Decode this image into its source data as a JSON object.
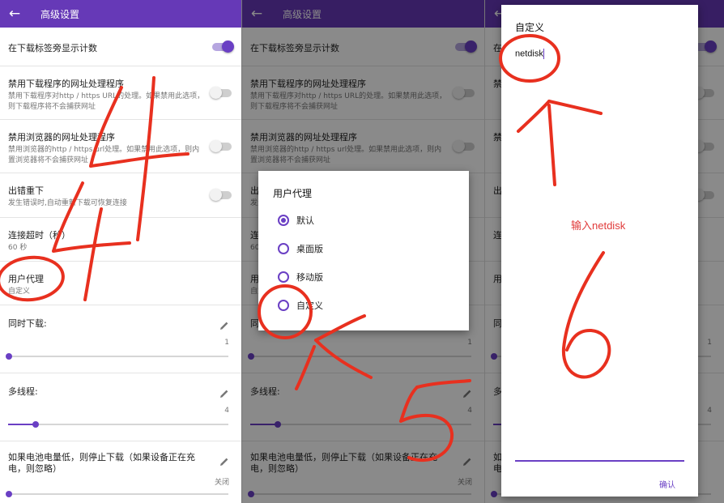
{
  "app_bar": {
    "back_icon": "arrow-left-icon",
    "title": "高级设置"
  },
  "settings": {
    "tab_count": {
      "title": "在下载标签旁显示计数",
      "enabled": true
    },
    "disable_downloader_handler": {
      "title": "禁用下载程序的网址处理程序",
      "desc": "禁用下载程序对http / https URL的处理。如果禁用此选项，则下载程序将不会捕获网址",
      "enabled": false
    },
    "disable_browser_handler": {
      "title": "禁用浏览器的网址处理程序",
      "desc": "禁用浏览器的http / https url处理。如果禁用此选项，则内置浏览器将不会捕获网址",
      "enabled": false
    },
    "retry_on_error": {
      "title": "出错重下",
      "desc": "发生错误时,自动重新下载可恢复连接",
      "enabled": false
    },
    "connect_timeout": {
      "title": "连接超时（秒）",
      "value": "60 秒"
    },
    "user_agent": {
      "title": "用户代理",
      "value": "自定义"
    },
    "concurrent_downloads": {
      "title": "同时下载:",
      "value": "1",
      "level": 0.0
    },
    "multithread": {
      "title": "多线程:",
      "value": "4",
      "level": 0.12
    },
    "low_battery": {
      "title": "如果电池电量低，则停止下载（如果设备正在充电，则忽略）",
      "value": "关闭",
      "level": 0.0
    }
  },
  "ua_dialog": {
    "title": "用户代理",
    "options": [
      {
        "label": "默认",
        "selected": true
      },
      {
        "label": "桌面版",
        "selected": false
      },
      {
        "label": "移动版",
        "selected": false
      },
      {
        "label": "自定义",
        "selected": false
      }
    ]
  },
  "custom_dialog": {
    "title": "自定义",
    "input_value": "netdisk",
    "confirm_label": "确认"
  },
  "annotations": {
    "note": "输入netdisk",
    "color": "#e8301f"
  },
  "colors": {
    "accent": "#6639b7",
    "annotation": "#e8301f"
  }
}
